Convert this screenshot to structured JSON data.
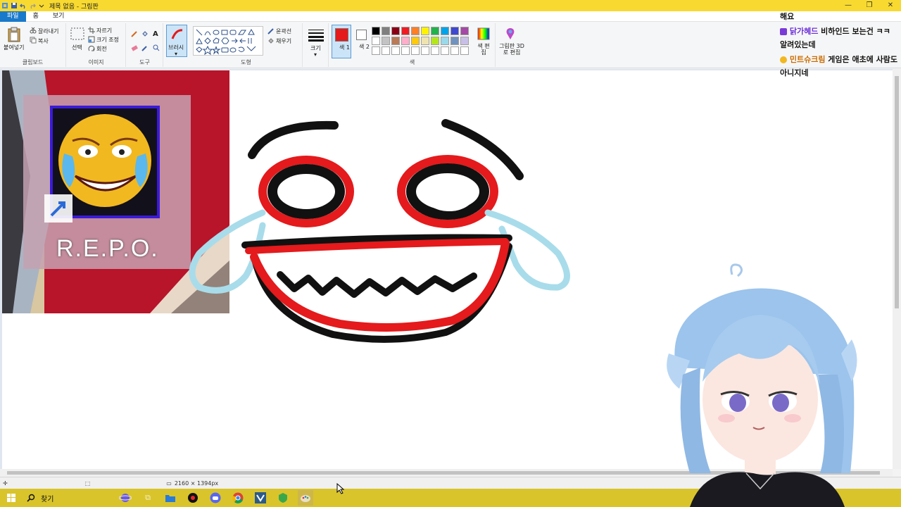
{
  "window": {
    "title": "제목 없음 - 그림판"
  },
  "menu_tabs": [
    "파일",
    "홈",
    "보기"
  ],
  "ribbon": {
    "clipboard": {
      "paste": "붙여넣기",
      "cut": "잘라내기",
      "copy": "복사",
      "label": "클립보드"
    },
    "image": {
      "select": "선택",
      "crop": "자르기",
      "resize": "크기 조정",
      "rotate": "회전",
      "label": "이미지"
    },
    "tools": {
      "label": "도구"
    },
    "brushes": {
      "label": "브러시"
    },
    "shapes": {
      "outline": "윤곽선",
      "fill": "채우기",
      "label": "도형"
    },
    "size": {
      "label": "크기"
    },
    "colors": {
      "color1": "색 1",
      "color2": "색 2",
      "edit": "색 편집",
      "label": "색",
      "color1_value": "#e41a1c",
      "color2_value": "#ffffff",
      "palette_row1": [
        "#000000",
        "#7f7f7f",
        "#880015",
        "#ed1c24",
        "#ff7f27",
        "#fff200",
        "#22b14c",
        "#00a2e8",
        "#3f48cc",
        "#a349a4"
      ],
      "palette_row2": [
        "#ffffff",
        "#c3c3c3",
        "#b97a57",
        "#ffaec9",
        "#ffc90e",
        "#efe4b0",
        "#b5e61d",
        "#99d9ea",
        "#7092be",
        "#c8bfe7"
      ],
      "palette_row3": [
        "#ffffff",
        "#ffffff",
        "#ffffff",
        "#ffffff",
        "#ffffff",
        "#ffffff",
        "#ffffff",
        "#ffffff",
        "#ffffff",
        "#ffffff"
      ]
    },
    "paint3d": "그림판 3D로 편집"
  },
  "canvas": {
    "pasted_image_caption": "R.E.P.O."
  },
  "status": {
    "dimensions": "2160 × 1394px"
  },
  "taskbar": {
    "search_label": "찾기"
  },
  "chat": [
    {
      "text": "해요"
    },
    {
      "nick": "닭가혜드",
      "text": "비하인드 보는건 ㅋㅋ 알려있는데"
    },
    {
      "nick": "민트슈크림",
      "text": "게임은 애초에 사람도 아니지네"
    }
  ]
}
